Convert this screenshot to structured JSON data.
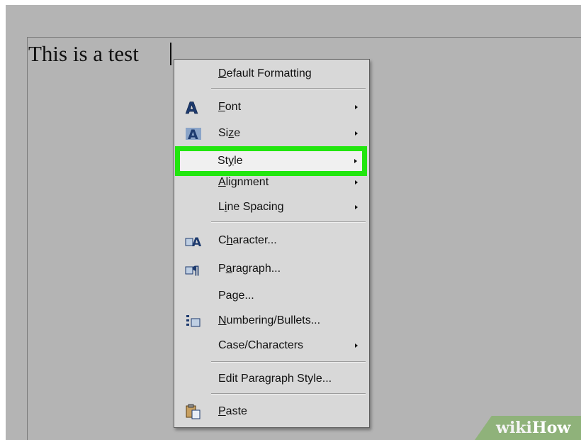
{
  "document": {
    "text": "This is a test"
  },
  "context_menu": {
    "items": [
      {
        "label": "Default Formatting",
        "underline": "D",
        "submenu": false,
        "icon": null
      },
      {
        "label": "Font",
        "underline": "F",
        "submenu": true,
        "icon": "font-icon"
      },
      {
        "label": "Size",
        "underline": "z",
        "submenu": true,
        "icon": "font-size-icon"
      },
      {
        "label": "Style",
        "underline": "y",
        "submenu": true,
        "icon": null,
        "highlighted": true
      },
      {
        "label": "Alignment",
        "underline": "A",
        "submenu": true,
        "icon": null
      },
      {
        "label": "Line Spacing",
        "underline": "i",
        "submenu": true,
        "icon": null
      },
      {
        "label": "Character...",
        "underline": "h",
        "submenu": false,
        "icon": "character-icon"
      },
      {
        "label": "Paragraph...",
        "underline": "a",
        "submenu": false,
        "icon": "paragraph-icon"
      },
      {
        "label": "Page...",
        "underline": "",
        "submenu": false,
        "icon": null
      },
      {
        "label": "Numbering/Bullets...",
        "underline": "N",
        "submenu": false,
        "icon": "numbering-bullets-icon"
      },
      {
        "label": "Case/Characters",
        "underline": "",
        "submenu": true,
        "icon": null
      },
      {
        "label": "Edit Paragraph Style...",
        "underline": "",
        "submenu": false,
        "icon": null
      },
      {
        "label": "Paste",
        "underline": "P",
        "submenu": false,
        "icon": "paste-icon"
      }
    ]
  },
  "highlight_color": "#22e60f",
  "watermark": {
    "text_part1": "wiki",
    "text_part2": "How"
  }
}
